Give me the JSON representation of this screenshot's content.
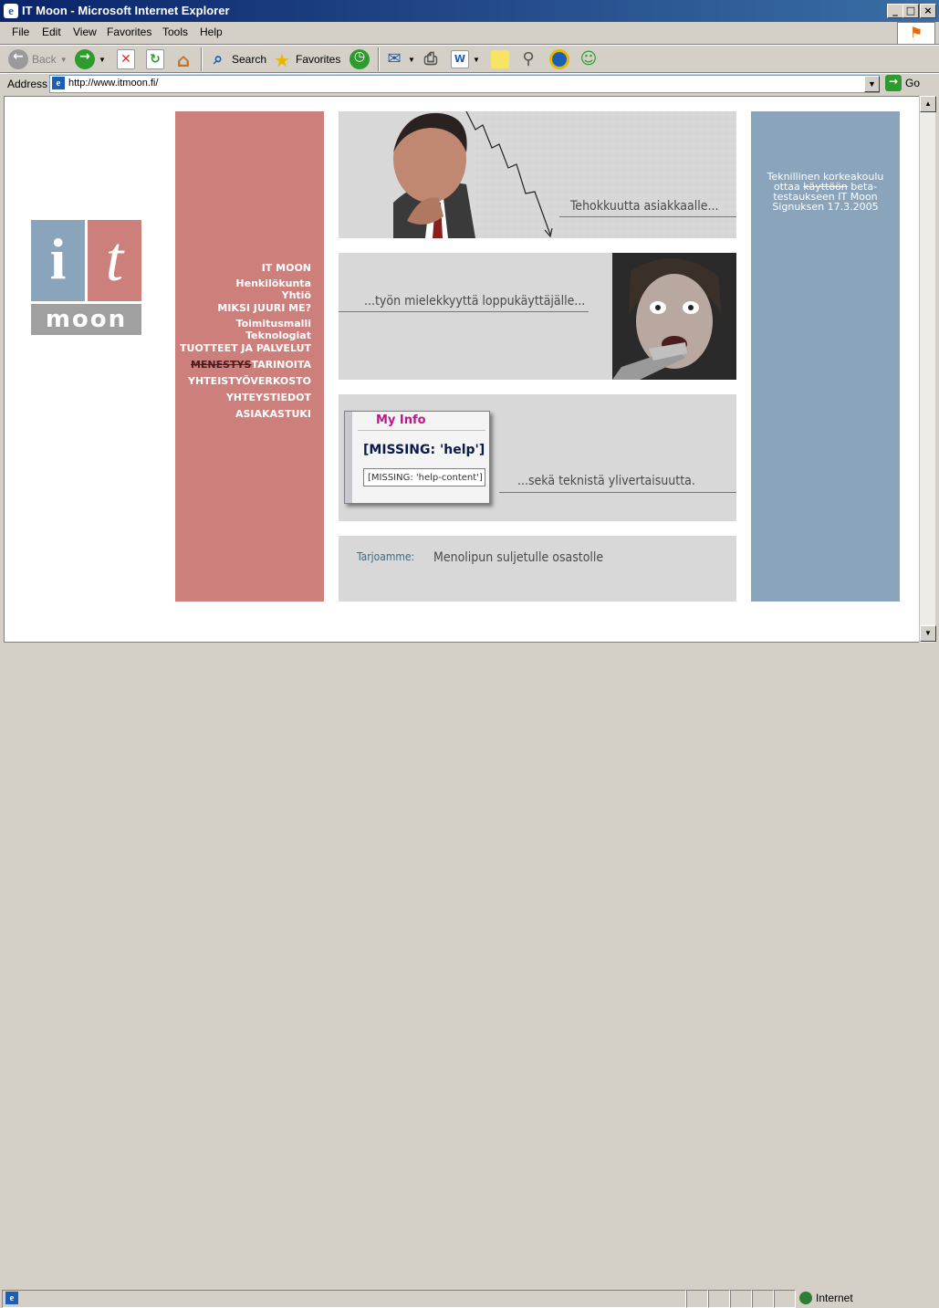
{
  "window": {
    "title": "IT Moon - Microsoft Internet Explorer"
  },
  "menu": {
    "items": [
      "File",
      "Edit",
      "View",
      "Favorites",
      "Tools",
      "Help"
    ]
  },
  "toolbar": {
    "back": "Back",
    "search": "Search",
    "favorites": "Favorites"
  },
  "address": {
    "label": "Address",
    "url": "http://www.itmoon.fi/",
    "go": "Go"
  },
  "page": {
    "logo": {
      "i": "i",
      "t": "t",
      "moon": "moon"
    },
    "nav": [
      "IT MOON",
      "Henkilökunta",
      "Yhtiö",
      "MIKSI JUURI ME?",
      "Toimitusmalli",
      "Teknologiat",
      "TUOTTEET JA PALVELUT",
      {
        "struck": "MENESTYS",
        "rest": "TARINOITA"
      },
      "YHTEISTYÖVERKOSTO",
      "YHTEYSTIEDOT",
      "ASIAKASTUKI"
    ],
    "banners": {
      "b1": "Tehokkuutta asiakkaalle...",
      "b2": "...työn mielekkyyttä loppukäyttäjälle...",
      "b3": "...sekä teknistä ylivertaisuutta.",
      "b4_label": "Tarjoamme:",
      "b4_text": "Menolipun suljetulle osastolle"
    },
    "myinfo": {
      "title": "My Info",
      "help": "[MISSING: 'help']",
      "help_content": "[MISSING: 'help-content']"
    },
    "news": {
      "line1": "Teknillinen korkeakoulu",
      "line2a": "ottaa ",
      "line2_struck": "käyttöön",
      "line2b": " beta-",
      "line3": "testaukseen IT Moon",
      "line4": "Signuksen 17.3.2005"
    }
  },
  "status": {
    "zone": "Internet"
  }
}
